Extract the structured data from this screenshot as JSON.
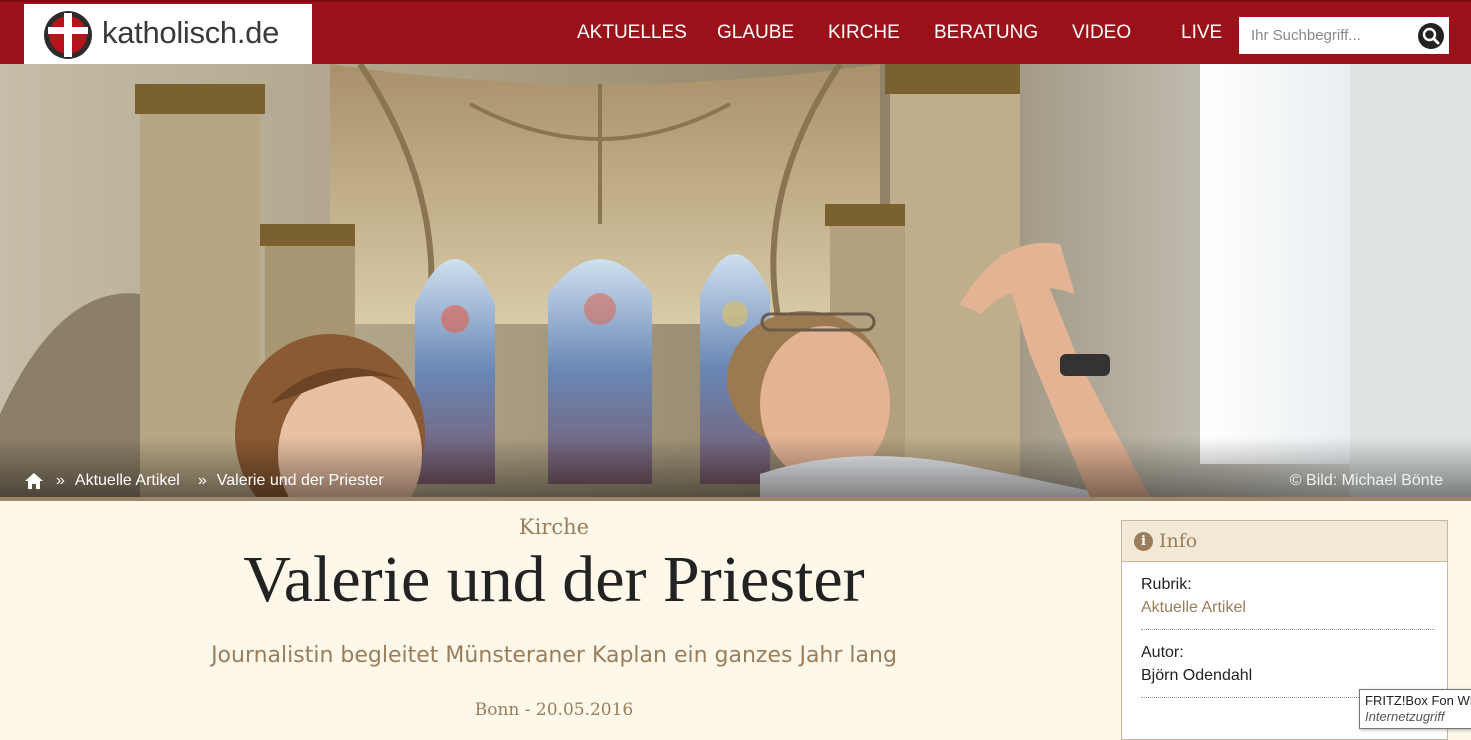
{
  "header": {
    "logo_text": "katholisch.de",
    "nav": [
      "AKTUELLES",
      "GLAUBE",
      "KIRCHE",
      "BERATUNG",
      "VIDEO",
      "LIVE"
    ],
    "search_placeholder": "Ihr Suchbegriff..."
  },
  "hero": {
    "breadcrumb": [
      "Aktuelle Artikel",
      "Valerie und der Priester"
    ],
    "photo_credit": "© Bild: Michael Bönte"
  },
  "article": {
    "kicker": "Kirche",
    "title": "Valerie und der Priester",
    "subtitle": "Journalistin begleitet Münsteraner Kaplan ein ganzes Jahr lang",
    "meta": "Bonn - 20.05.2016"
  },
  "info": {
    "heading": "Info",
    "rows": [
      {
        "label": "Rubrik:",
        "value": "Aktuelle Artikel"
      },
      {
        "label": "Autor:",
        "value": "Björn Odendahl"
      }
    ]
  },
  "tooltip": {
    "line1": "FRITZ!Box Fon WLAN",
    "line2": "Internetzugriff"
  },
  "colors": {
    "brand_red": "#9b1119",
    "accent_brown": "#9a7e5c",
    "page_bg": "#fdf8e9"
  }
}
